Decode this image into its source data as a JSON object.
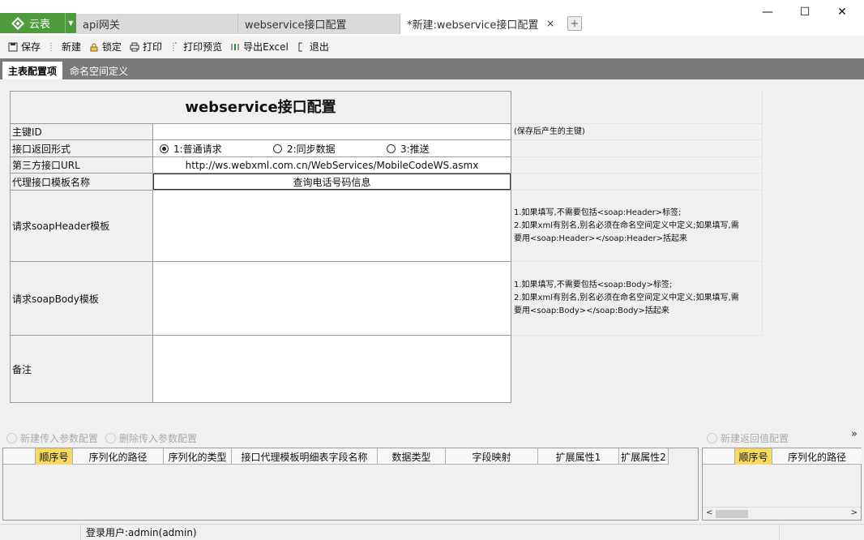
{
  "app": {
    "name": "云表"
  },
  "tabs": [
    {
      "label": "api网关"
    },
    {
      "label": "webservice接口配置"
    },
    {
      "label": "*新建:webservice接口配置",
      "close": "×"
    }
  ],
  "window_controls": {
    "minimize": "—",
    "maximize": "☐",
    "close": "✕"
  },
  "toolbar": {
    "save": "保存",
    "new": "新建",
    "lock": "锁定",
    "print": "打印",
    "print_preview": "打印预览",
    "export_excel": "导出Excel",
    "exit": "退出"
  },
  "page_tabs": [
    {
      "label": "主表配置项"
    },
    {
      "label": "命名空间定义"
    }
  ],
  "form": {
    "title": "webservice接口配置",
    "fields": {
      "primary_key": {
        "label": "主键ID",
        "value": "",
        "note": "(保存后产生的主键)"
      },
      "return_mode": {
        "label": "接口返回形式",
        "options": [
          "1:普通请求",
          "2:同步数据",
          "3:推送"
        ],
        "selected": "1:普通请求"
      },
      "third_party_url": {
        "label": "第三方接口URL",
        "value": "http://ws.webxml.com.cn/WebServices/MobileCodeWS.asmx"
      },
      "proxy_template": {
        "label": "代理接口模板名称",
        "value": "查询电话号码信息"
      },
      "soap_header": {
        "label": "请求soapHeader模板",
        "value": "",
        "note_lines": [
          "1.如果填写,不需要包括<soap:Header>标签;",
          "2.如果xml有别名,别名必须在命名空间定义中定义;如果填写,需",
          "要用<soap:Header></soap:Header>括起来"
        ]
      },
      "soap_body": {
        "label": "请求soapBody模板",
        "value": "",
        "note_lines": [
          "1.如果填写,不需要包括<soap:Body>标签;",
          "2.如果xml有别名,别名必须在命名空间定义中定义;如果填写,需",
          "要用<soap:Body></soap:Body>括起来"
        ]
      },
      "remark": {
        "label": "备注",
        "value": ""
      }
    }
  },
  "params": {
    "new_label": "新建传入参数配置",
    "delete_label": "删除传入参数配置",
    "columns": [
      "顺序号",
      "序列化的路径",
      "序列化的类型",
      "接口代理模板明细表字段名称",
      "数据类型",
      "字段映射",
      "扩展属性1",
      "扩展属性2"
    ]
  },
  "returns": {
    "new_label": "新建返回值配置",
    "columns": [
      "顺序号",
      "序列化的路径"
    ]
  },
  "expand_glyph": "»",
  "status": {
    "user": "登录用户:admin(admin)"
  }
}
